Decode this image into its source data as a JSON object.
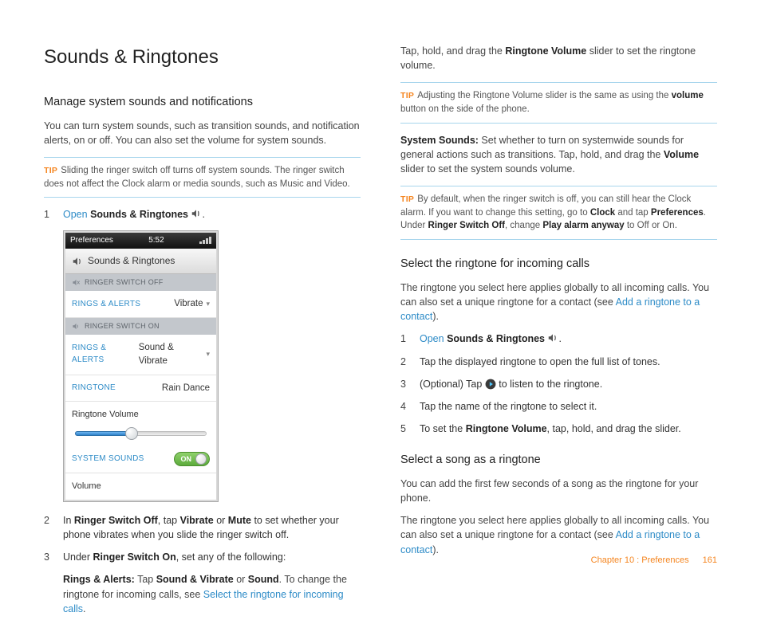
{
  "title": "Sounds & Ringtones",
  "left": {
    "h2": "Manage system sounds and notifications",
    "intro": "You can turn system sounds, such as transition sounds, and notification alerts, on or off. You can also set the volume for system sounds.",
    "tip1_label": "TIP",
    "tip1": "Sliding the ringer switch off turns off system sounds. The ringer switch does not affect the Clock alarm or media sounds, such as Music and Video.",
    "step1_open": "Open",
    "step1_app": "Sounds & Ringtones",
    "step2_pre": "In ",
    "step2_b1": "Ringer Switch Off",
    "step2_mid1": ", tap ",
    "step2_b2": "Vibrate",
    "step2_mid2": " or ",
    "step2_b3": "Mute",
    "step2_post": " to set whether your phone vibrates when you slide the ringer switch off.",
    "step3_pre": "Under ",
    "step3_b1": "Ringer Switch On",
    "step3_post": ", set any of the following:",
    "rings_b": "Rings & Alerts:",
    "rings_mid1": " Tap ",
    "rings_b2": "Sound & Vibrate",
    "rings_mid2": " or ",
    "rings_b3": "Sound",
    "rings_mid3": ". To change the ringtone for incoming calls, see ",
    "rings_link": "Select the ringtone for incoming calls",
    "rings_end": "."
  },
  "phone": {
    "prefs": "Preferences",
    "time": "5:52",
    "title": "Sounds & Ringtones",
    "hdr_off": "RINGER SWITCH OFF",
    "row_off_lbl": "RINGS & ALERTS",
    "row_off_val": "Vibrate",
    "hdr_on": "RINGER SWITCH ON",
    "row_on_lbl": "RINGS & ALERTS",
    "row_on_val": "Sound & Vibrate",
    "row_rt_lbl": "RINGTONE",
    "row_rt_val": "Rain Dance",
    "rvol": "Ringtone Volume",
    "sys_lbl": "SYSTEM SOUNDS",
    "on": "ON",
    "vol": "Volume"
  },
  "right": {
    "drag_pre": "Tap, hold, and drag the ",
    "drag_b": "Ringtone Volume",
    "drag_post": " slider to set the ringtone volume.",
    "tip2_label": "TIP",
    "tip2_a": "Adjusting the Ringtone Volume slider is the same as using the ",
    "tip2_b": "volume",
    "tip2_c": " button on the side of the phone.",
    "sys_b": "System Sounds:",
    "sys_mid": " Set whether to turn on systemwide sounds for general actions such as transitions. Tap, hold, and drag the ",
    "sys_b2": "Volume",
    "sys_post": " slider to set the system sounds volume.",
    "tip3_label": "TIP",
    "tip3_a": "By default, when the ringer switch is off, you can still hear the Clock alarm. If you want to change this setting, go to ",
    "tip3_b1": "Clock",
    "tip3_mid1": " and tap ",
    "tip3_b2": "Preferences",
    "tip3_mid2": ". Under ",
    "tip3_b3": "Ringer Switch Off",
    "tip3_mid3": ", change ",
    "tip3_b4": "Play alarm anyway",
    "tip3_end": " to Off or On.",
    "h2a": "Select the ringtone for incoming calls",
    "pa": "The ringtone you select here applies globally to all incoming calls. You can also set a unique ringtone for a contact (see ",
    "pa_link": "Add a ringtone to a contact",
    "pa_end": ").",
    "s1_open": "Open",
    "s1_app": "Sounds & Ringtones",
    "s2": "Tap the displayed ringtone to open the full list of tones.",
    "s3_a": "(Optional) Tap ",
    "s3_b": " to listen to the ringtone.",
    "s4": "Tap the name of the ringtone to select it.",
    "s5_a": "To set the ",
    "s5_b": "Ringtone Volume",
    "s5_c": ", tap, hold, and drag the slider.",
    "h2b": "Select a song as a ringtone",
    "pb": "You can add the first few seconds of a song as the ringtone for your phone.",
    "pc": "The ringtone you select here applies globally to all incoming calls. You can also set a unique ringtone for a contact (see ",
    "pc_link": "Add a ringtone to a contact",
    "pc_end": ")."
  },
  "footer": {
    "chapter": "Chapter 10 : Preferences",
    "page": "161"
  }
}
